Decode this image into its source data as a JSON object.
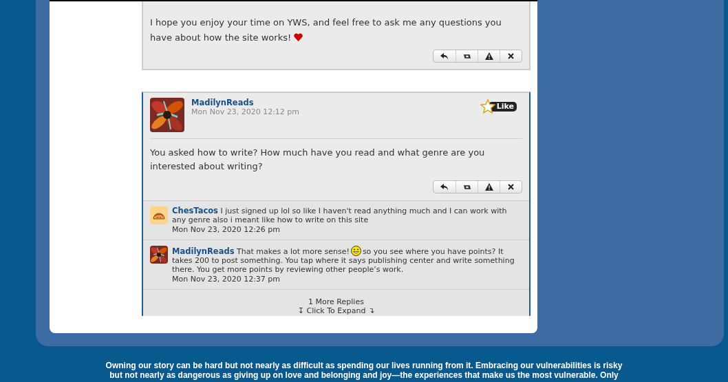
{
  "posts": [
    {
      "kind": "tail",
      "body": "I hope you enjoy your time on YWS, and feel free to ask me any questions you have about how the site works!",
      "heart": true,
      "actions": [
        {
          "kind": "reply"
        },
        {
          "kind": "retweet"
        },
        {
          "kind": "report"
        },
        {
          "kind": "delete"
        }
      ]
    },
    {
      "kind": "full",
      "author": "MadilynReads",
      "date": "Mon Nov 23, 2020 12:12 pm",
      "like": "Like",
      "body": "You asked how to write? How much have you read and what genre are you interested about writing?",
      "actions": [
        {
          "kind": "reply"
        },
        {
          "kind": "retweet"
        },
        {
          "kind": "report"
        },
        {
          "kind": "delete"
        }
      ],
      "comments": [
        {
          "kind": "taco",
          "author": "ChesTacos",
          "text": "I just signed up lol so like I haven't read anything much and I can work with any genre also i meant like how to write on this site",
          "date": "Mon Nov 23, 2020 12:26 pm"
        },
        {
          "author": "MadilynReads",
          "text": "That makes a lot more sense!",
          "smiley": true,
          "text_after": "so you see where you have points? It takes 200 to post something. You tap where it says publishing center and write something there. You get more points by reviewing other people’s work.",
          "date": "Mon Nov 23, 2020 12:37 pm"
        }
      ],
      "more_replies": "1 More Replies",
      "expand": "↧ Click To Expand ↴"
    }
  ],
  "footer_quote": [
    "Owning our story can be hard but not nearly as difficult as spending our lives running from it. Embracing our vulnerabilities is risky",
    "but not nearly as dangerous as giving up on love and belonging and joy—the experiences that make us the most vulnerable. Only"
  ]
}
